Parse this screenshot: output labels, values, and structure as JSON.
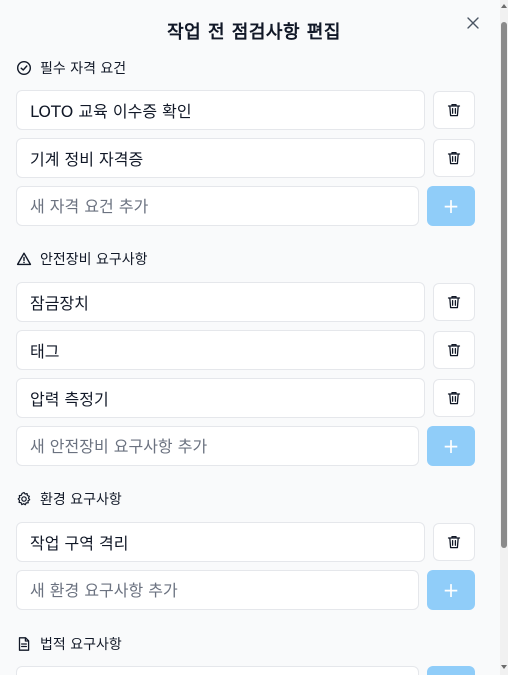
{
  "dialog": {
    "title": "작업 전 점검사항 편집",
    "close_icon": "close-icon"
  },
  "sections": {
    "qualifications": {
      "heading": "필수 자격 요건",
      "icon": "check-circle-icon",
      "items": [
        "LOTO 교육 이수증 확인",
        "기계 정비 자격증"
      ],
      "placeholder": "새 자격 요건 추가"
    },
    "safety": {
      "heading": "안전장비 요구사항",
      "icon": "warning-triangle-icon",
      "items": [
        "잠금장치",
        "태그",
        "압력 측정기"
      ],
      "placeholder": "새 안전장비 요구사항 추가"
    },
    "environment": {
      "heading": "환경 요구사항",
      "icon": "gear-icon",
      "items": [
        "작업 구역 격리"
      ],
      "placeholder": "새 환경 요구사항 추가"
    },
    "legal": {
      "heading": "법적 요구사항",
      "icon": "document-icon"
    }
  },
  "add_symbol": "+",
  "colors": {
    "add_button": "#90cdf9",
    "border": "#e5e7eb",
    "placeholder": "#6b7280",
    "background": "#f9fafb"
  }
}
